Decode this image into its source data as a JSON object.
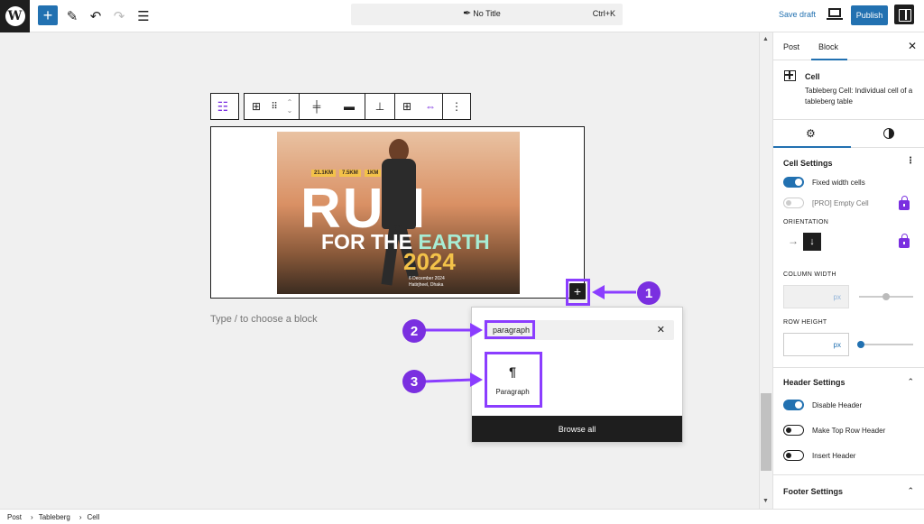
{
  "topbar": {
    "add_icon": "plus-icon",
    "doc_title": "No Title",
    "shortcut": "Ctrl+K",
    "save_draft": "Save draft",
    "publish": "Publish"
  },
  "editor": {
    "type_hint": "Type / to choose a block",
    "poster": {
      "distances": [
        "21.1KM",
        "7.5KM",
        "1KM"
      ],
      "run": "RUN",
      "for_the": "FOR THE",
      "earth": "EARTH",
      "year": "2024",
      "date_line1": "6 December 2024",
      "date_line2": "Hatirjheel, Dhaka"
    }
  },
  "inserter": {
    "search_value": "paragraph",
    "item_label": "Paragraph",
    "item_icon": "pilcrow-icon",
    "browse_all": "Browse all"
  },
  "callouts": [
    "1",
    "2",
    "3"
  ],
  "accent_color": "#8b3dff",
  "sidebar": {
    "tabs": [
      "Post",
      "Block"
    ],
    "active_tab": "Block",
    "block_title": "Cell",
    "block_desc": "Tableberg Cell: Individual cell of a tableberg table",
    "cell_settings": "Cell Settings",
    "fixed_width": "Fixed width cells",
    "empty_cell": "[PRO] Empty Cell",
    "orientation": "ORIENTATION",
    "column_width": "COLUMN WIDTH",
    "row_height": "ROW HEIGHT",
    "unit": "px",
    "header_settings": "Header Settings",
    "disable_header": "Disable Header",
    "make_top_row_header": "Make Top Row Header",
    "insert_header": "Insert Header",
    "footer_settings": "Footer Settings"
  },
  "breadcrumb": [
    "Post",
    "Tableberg",
    "Cell"
  ]
}
